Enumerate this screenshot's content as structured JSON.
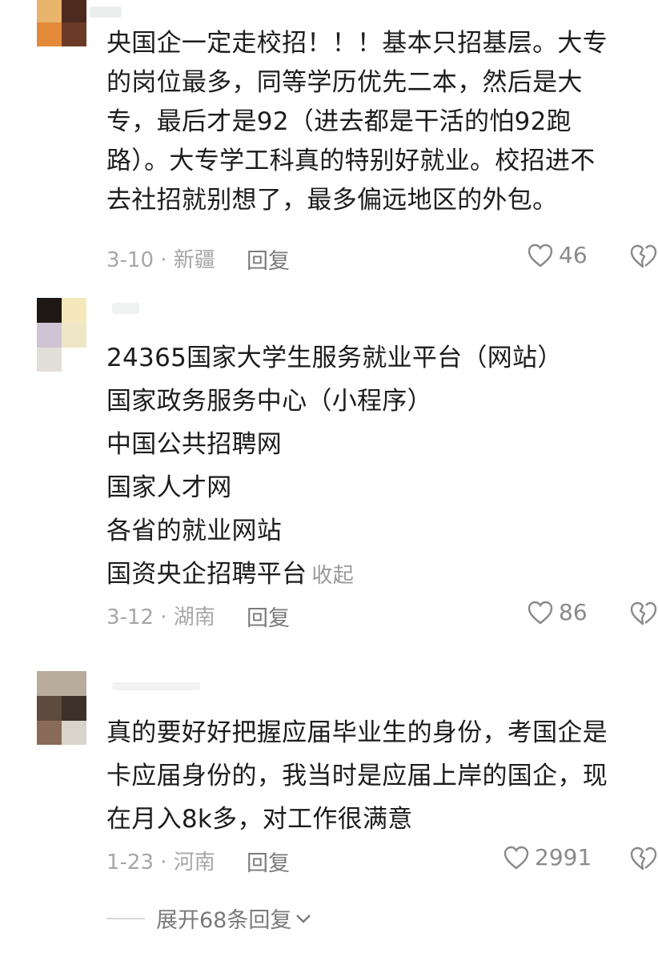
{
  "comments": [
    {
      "lines": [
        "央国企一定走校招！！！基本只招基层。大专",
        "的岗位最多，同等学历优先二本，然后是大",
        "专，最后才是92（进去都是干活的怕92跑",
        "路）。大专学工科真的特别好就业。校招进不",
        "去社招就别想了，最多偏远地区的外包。"
      ],
      "meta": "3-10 · 新疆",
      "reply_label": "回复",
      "likes": "46"
    },
    {
      "lines": [
        "24365国家大学生服务就业平台（网站）",
        "国家政务服务中心（小程序）",
        "中国公共招聘网",
        "国家人才网",
        "各省的就业网站",
        "国资央企招聘平台"
      ],
      "collapse_label": "收起",
      "meta": "3-12 · 湖南",
      "reply_label": "回复",
      "likes": "86"
    },
    {
      "lines": [
        "真的要好好把握应届毕业生的身份，考国企是",
        "卡应届身份的，我当时是应届上岸的国企，现",
        "在月入8k多，对工作很满意"
      ],
      "meta": "1-23 · 河南",
      "reply_label": "回复",
      "likes": "2991"
    }
  ],
  "expand_replies": "展开68条回复",
  "icons": [
    "heart-outline-icon",
    "broken-heart-icon",
    "chevron-down-icon"
  ],
  "colors": {
    "text": "#1c1c1c",
    "muted": "#a6a6a6",
    "reply": "#7b7b7b"
  }
}
